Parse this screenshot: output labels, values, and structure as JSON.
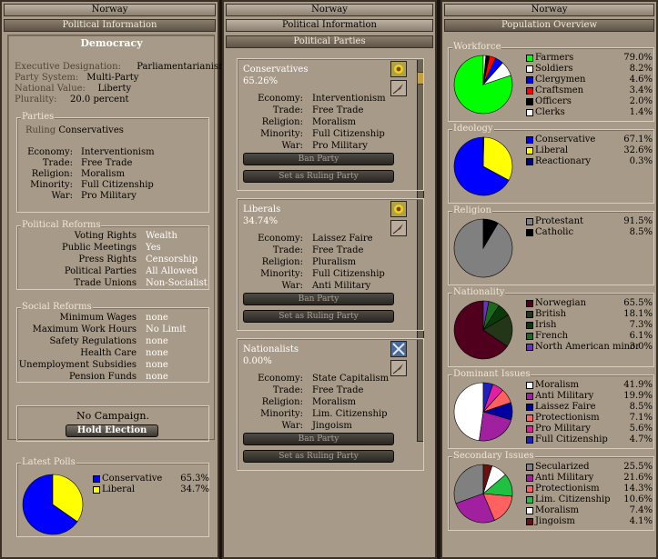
{
  "country": "Norway",
  "left": {
    "banner_sub": "Political Information",
    "government": "Democracy",
    "info": [
      {
        "k": "Executive Designation:",
        "v": "Parliamentarianism"
      },
      {
        "k": "Party System:",
        "v": "Multi-Party"
      },
      {
        "k": "National Value:",
        "v": "Liberty"
      },
      {
        "k": "Plurality:",
        "v": "20.0 percent"
      }
    ],
    "parties_legend": "Parties",
    "ruling_label": "Ruling",
    "ruling_party": "Conservatives",
    "party_policies": [
      {
        "k": "Economy:",
        "v": "Interventionism"
      },
      {
        "k": "Trade:",
        "v": "Free Trade"
      },
      {
        "k": "Religion:",
        "v": "Moralism"
      },
      {
        "k": "Minority:",
        "v": "Full Citizenship"
      },
      {
        "k": "War:",
        "v": "Pro Military"
      }
    ],
    "political_reforms_legend": "Political Reforms",
    "political_reforms": [
      {
        "k": "Voting Rights",
        "v": "Wealth"
      },
      {
        "k": "Public Meetings",
        "v": "Yes"
      },
      {
        "k": "Press Rights",
        "v": "Censorship"
      },
      {
        "k": "Political Parties",
        "v": "All Allowed"
      },
      {
        "k": "Trade Unions",
        "v": "Non-Socialist"
      }
    ],
    "social_reforms_legend": "Social Reforms",
    "social_reforms": [
      {
        "k": "Minimum Wages",
        "v": "none"
      },
      {
        "k": "Maximum Work Hours",
        "v": "No Limit"
      },
      {
        "k": "Safety Regulations",
        "v": "none"
      },
      {
        "k": "Health Care",
        "v": "none"
      },
      {
        "k": "Unemployment Subsidies",
        "v": "none"
      },
      {
        "k": "Pension Funds",
        "v": "none"
      }
    ],
    "campaign_text": "No Campaign.",
    "hold_election_label": "Hold Election",
    "polls_legend": "Latest Polls",
    "polls": [
      {
        "name": "Conservative",
        "value": 65.3,
        "label": "65.3%",
        "color": "#0000ff"
      },
      {
        "name": "Liberal",
        "value": 34.7,
        "label": "34.7%",
        "color": "#ffff00"
      }
    ]
  },
  "middle": {
    "banner_sub": "Political Information",
    "banner_sub2": "Political Parties",
    "ban_label": "Ban Party",
    "ruling_btn_label": "Set as Ruling Party",
    "parties": [
      {
        "name": "Conservatives",
        "share": "65.26%",
        "icon": "sunflower-icon",
        "policies": [
          {
            "k": "Economy:",
            "v": "Interventionism"
          },
          {
            "k": "Trade:",
            "v": "Free Trade"
          },
          {
            "k": "Religion:",
            "v": "Moralism"
          },
          {
            "k": "Minority:",
            "v": "Full Citizenship"
          },
          {
            "k": "War:",
            "v": "Pro Military"
          }
        ]
      },
      {
        "name": "Liberals",
        "share": "34.74%",
        "icon": "sunflower-icon",
        "policies": [
          {
            "k": "Economy:",
            "v": "Laissez Faire"
          },
          {
            "k": "Trade:",
            "v": "Free Trade"
          },
          {
            "k": "Religion:",
            "v": "Pluralism"
          },
          {
            "k": "Minority:",
            "v": "Full Citizenship"
          },
          {
            "k": "War:",
            "v": "Anti Military"
          }
        ]
      },
      {
        "name": "Nationalists",
        "share": "0.00%",
        "icon": "crossed-swords-icon",
        "policies": [
          {
            "k": "Economy:",
            "v": "State Capitalism"
          },
          {
            "k": "Trade:",
            "v": "Free Trade"
          },
          {
            "k": "Religion:",
            "v": "Moralism"
          },
          {
            "k": "Minority:",
            "v": "Lim. Citizenship"
          },
          {
            "k": "War:",
            "v": "Jingoism"
          }
        ]
      }
    ]
  },
  "right": {
    "banner_sub": "Population Overview",
    "chart_data": [
      {
        "type": "pie",
        "title": "Workforce",
        "series": [
          {
            "name": "Farmers",
            "value": 79.0,
            "label": "79.0%",
            "color": "#00ff00"
          },
          {
            "name": "Soldiers",
            "value": 8.2,
            "label": "8.2%",
            "color": "#ffffff"
          },
          {
            "name": "Clergymen",
            "value": 4.6,
            "label": "4.6%",
            "color": "#0000ff"
          },
          {
            "name": "Craftsmen",
            "value": 3.4,
            "label": "3.4%",
            "color": "#ff0000"
          },
          {
            "name": "Officers",
            "value": 2.0,
            "label": "2.0%",
            "color": "#000000"
          },
          {
            "name": "Clerks",
            "value": 1.4,
            "label": "1.4%",
            "color": "#ffffff"
          }
        ]
      },
      {
        "type": "pie",
        "title": "Ideology",
        "series": [
          {
            "name": "Conservative",
            "value": 67.1,
            "label": "67.1%",
            "color": "#0000ff"
          },
          {
            "name": "Liberal",
            "value": 32.6,
            "label": "32.6%",
            "color": "#ffff00"
          },
          {
            "name": "Reactionary",
            "value": 0.3,
            "label": "0.3%",
            "color": "#00007a"
          }
        ]
      },
      {
        "type": "pie",
        "title": "Religion",
        "series": [
          {
            "name": "Protestant",
            "value": 91.5,
            "label": "91.5%",
            "color": "#808080"
          },
          {
            "name": "Catholic",
            "value": 8.5,
            "label": "8.5%",
            "color": "#000000"
          }
        ]
      },
      {
        "type": "pie",
        "title": "Nationality",
        "series": [
          {
            "name": "Norwegian",
            "value": 65.5,
            "label": "65.5%",
            "color": "#50001c"
          },
          {
            "name": "British",
            "value": 18.1,
            "label": "18.1%",
            "color": "#243618"
          },
          {
            "name": "Irish",
            "value": 7.3,
            "label": "7.3%",
            "color": "#0a3a0a"
          },
          {
            "name": "French",
            "value": 6.1,
            "label": "6.1%",
            "color": "#1a6a1a"
          },
          {
            "name": "North American minor",
            "value": 3.0,
            "label": "3.0%",
            "color": "#6a32c0"
          }
        ]
      },
      {
        "type": "pie",
        "title": "Dominant Issues",
        "series": [
          {
            "name": "Moralism",
            "value": 41.9,
            "label": "41.9%",
            "color": "#ffffff"
          },
          {
            "name": "Anti Military",
            "value": 19.9,
            "label": "19.9%",
            "color": "#a020a0"
          },
          {
            "name": "Laissez Faire",
            "value": 8.5,
            "label": "8.5%",
            "color": "#0000a0"
          },
          {
            "name": "Protectionism",
            "value": 7.1,
            "label": "7.1%",
            "color": "#ff6060"
          },
          {
            "name": "Pro Military",
            "value": 5.6,
            "label": "5.6%",
            "color": "#e020a0"
          },
          {
            "name": "Full Citizenship",
            "value": 4.7,
            "label": "4.7%",
            "color": "#2020c0"
          }
        ]
      },
      {
        "type": "pie",
        "title": "Secondary Issues",
        "series": [
          {
            "name": "Secularized",
            "value": 25.5,
            "label": "25.5%",
            "color": "#808080"
          },
          {
            "name": "Anti Military",
            "value": 21.6,
            "label": "21.6%",
            "color": "#a020a0"
          },
          {
            "name": "Protectionism",
            "value": 14.3,
            "label": "14.3%",
            "color": "#ff6060"
          },
          {
            "name": "Lim. Citizenship",
            "value": 10.6,
            "label": "10.6%",
            "color": "#20c040"
          },
          {
            "name": "Moralism",
            "value": 7.4,
            "label": "7.4%",
            "color": "#ffffff"
          },
          {
            "name": "Jingoism",
            "value": 4.1,
            "label": "4.1%",
            "color": "#6a1010"
          }
        ]
      }
    ]
  }
}
